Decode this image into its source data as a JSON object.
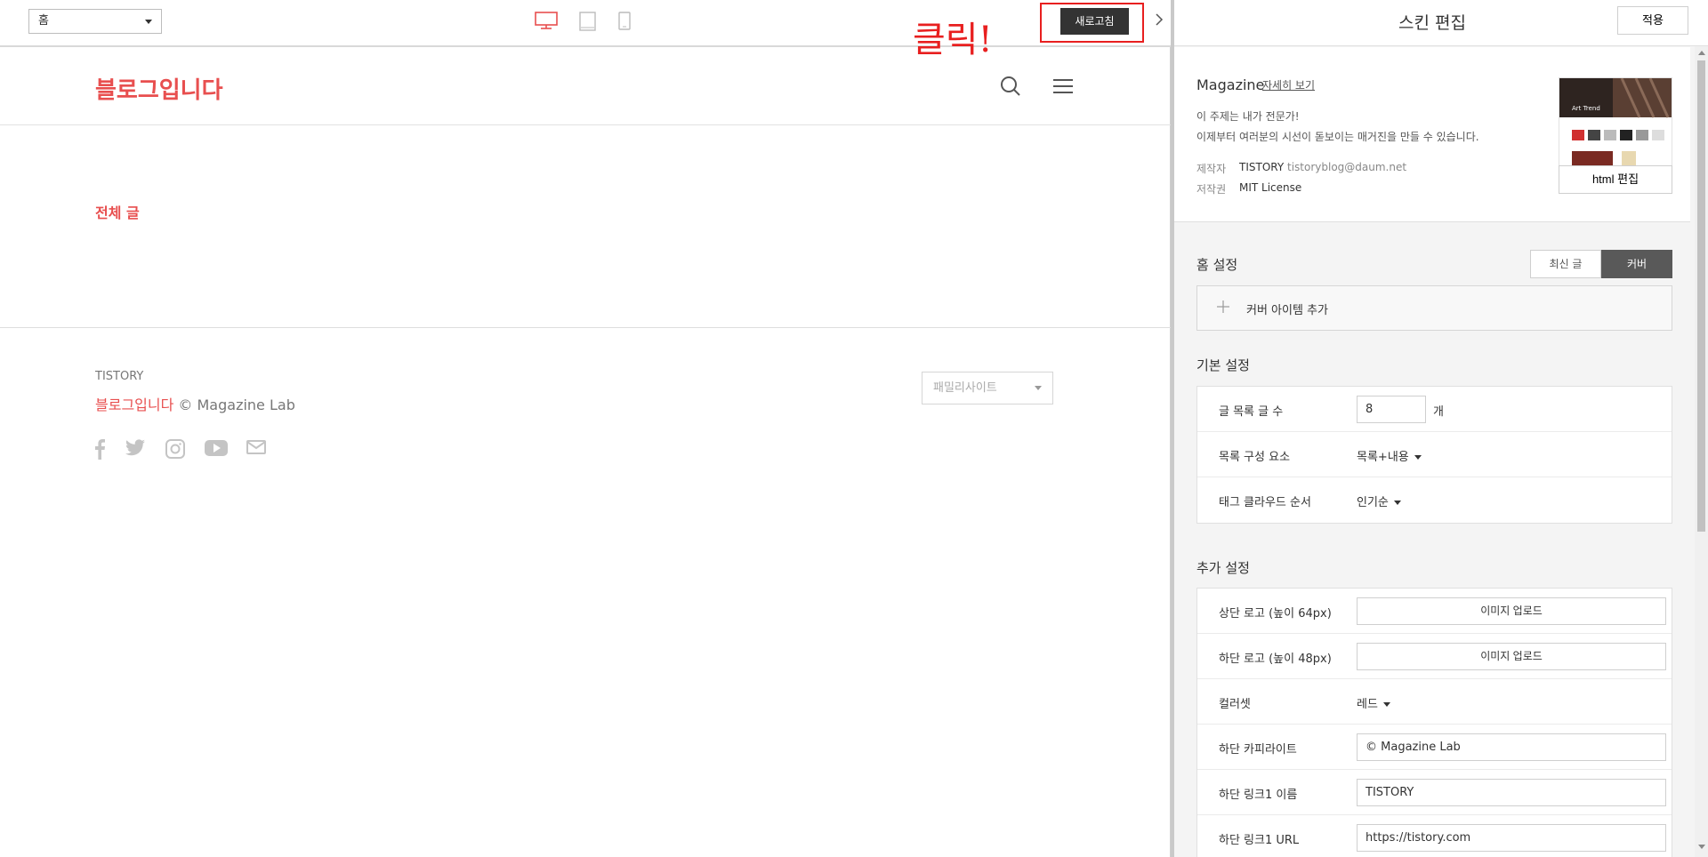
{
  "topbar": {
    "page_select_value": "홈",
    "refresh_label": "새로고침",
    "annotation": "클릭!"
  },
  "blog": {
    "title": "블로그입니다",
    "all_posts": "전체 글",
    "footer_link": "TISTORY",
    "footer_blog_name": "블로그입니다",
    "footer_copyright": " © Magazine Lab",
    "family_site_placeholder": "패밀리사이트"
  },
  "panel": {
    "title": "스킨 편집",
    "apply_label": "적용",
    "skin_name": "Magazine",
    "more_link": "자세히 보기",
    "desc_line1": "이 주제는 내가 전문가!",
    "desc_line2": "이제부터 여러분의 시선이 돋보이는 매거진을 만들 수 있습니다.",
    "maker_key": "제작자",
    "maker_name": "TISTORY",
    "maker_email": "tistoryblog@daum.net",
    "license_key": "저작권",
    "license_val": "MIT License",
    "thumb_text": "Art Trend",
    "html_edit_label": "html 편집",
    "home_section": {
      "title": "홈 설정",
      "toggle": [
        "최신 글",
        "커버"
      ],
      "active_toggle": "커버",
      "add_cover_label": "커버 아이템 추가"
    },
    "basic_section": {
      "title": "기본 설정",
      "rows": [
        {
          "label": "글 목록 글 수",
          "value": "8",
          "unit": "개"
        },
        {
          "label": "목록 구성 요소",
          "value": "목록+내용"
        },
        {
          "label": "태그 클라우드 순서",
          "value": "인기순"
        }
      ]
    },
    "extra_section": {
      "title": "추가 설정",
      "rows": [
        {
          "label": "상단 로고 (높이 64px)",
          "button": "이미지 업로드"
        },
        {
          "label": "하단 로고 (높이 48px)",
          "button": "이미지 업로드"
        },
        {
          "label": "컬러셋",
          "value": "레드"
        },
        {
          "label": "하단 카피라이트",
          "value": "© Magazine Lab"
        },
        {
          "label": "하단 링크1 이름",
          "value": "TISTORY"
        },
        {
          "label": "하단 링크1 URL",
          "value": "https://tistory.com"
        }
      ]
    }
  },
  "colors": {
    "accent": "#e84f4f",
    "annotation": "#e81f1f",
    "dark_button": "#333333"
  },
  "icons": [
    "desktop-icon",
    "tablet-icon",
    "mobile-icon",
    "search-icon",
    "menu-icon",
    "facebook-icon",
    "twitter-icon",
    "instagram-icon",
    "youtube-icon",
    "mail-icon",
    "plus-icon",
    "chevron-right-icon"
  ]
}
